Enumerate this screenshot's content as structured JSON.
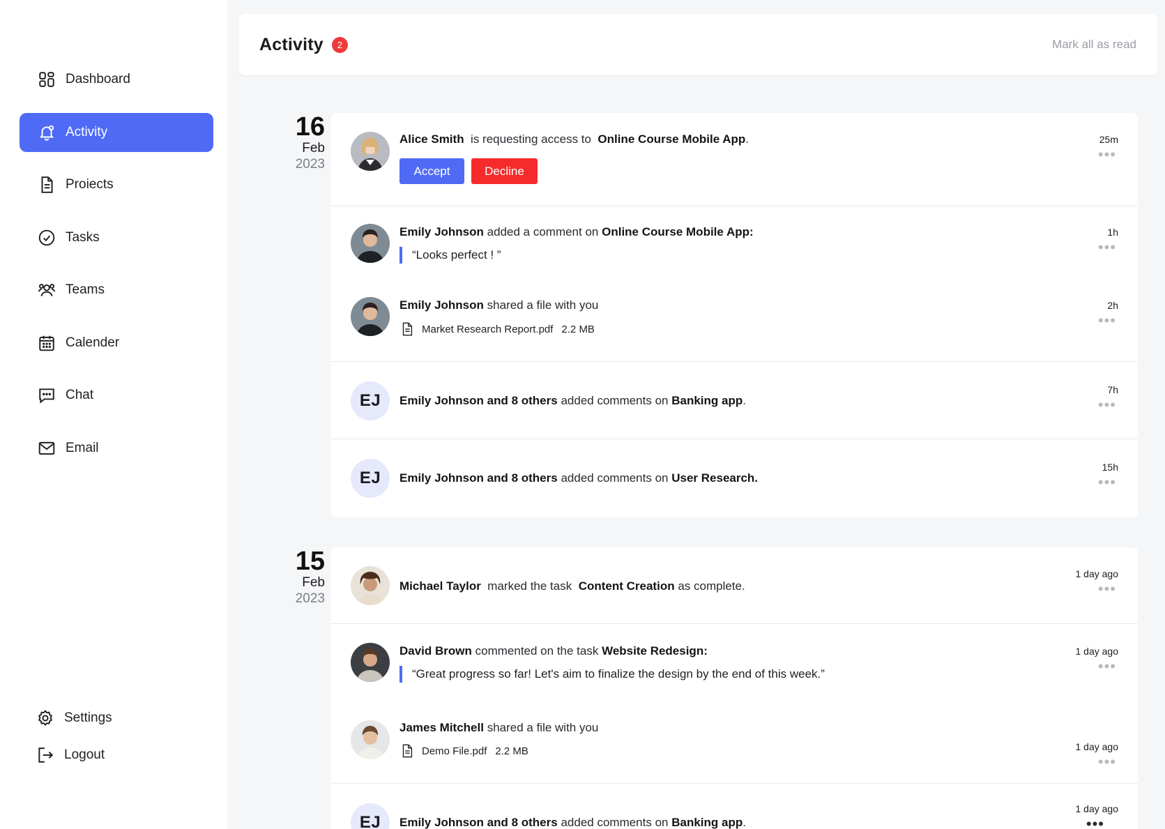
{
  "sidebar": {
    "items": [
      {
        "label": "Dashboard",
        "icon": "dashboard-icon"
      },
      {
        "label": "Activity",
        "icon": "bell-icon",
        "active": true
      },
      {
        "label": "Proiects",
        "icon": "document-icon"
      },
      {
        "label": "Tasks",
        "icon": "check-circle-icon"
      },
      {
        "label": "Teams",
        "icon": "users-icon"
      },
      {
        "label": "Calender",
        "icon": "calendar-icon"
      },
      {
        "label": "Chat",
        "icon": "chat-icon"
      },
      {
        "label": "Email",
        "icon": "mail-icon"
      }
    ],
    "bottom": [
      {
        "label": "Settings",
        "icon": "gear-icon"
      },
      {
        "label": "Logout",
        "icon": "logout-icon"
      }
    ],
    "accent": "#4f6bf6"
  },
  "header": {
    "title": "Activity",
    "badge": "2",
    "mark_all": "Mark all as read"
  },
  "groups": [
    {
      "day": "16",
      "month": "Feb",
      "year": "2023",
      "items": [
        {
          "actor": "Alice Smith",
          "verb": "is requesting access to",
          "target": "Online Course Mobile App",
          "end": ".",
          "time": "25m",
          "accept": "Accept",
          "decline": "Decline"
        },
        {
          "actor": "Emily Johnson",
          "verb": "added a comment on",
          "target": "Online Course Mobile App:",
          "quote": "“Looks perfect ! ”",
          "time": "1h"
        },
        {
          "actor": "Emily Johnson",
          "verb": "shared a file with you",
          "file_name": "Market Research Report.pdf",
          "file_size": "2.2 MB",
          "time": "2h"
        },
        {
          "initials": "EJ",
          "actor": "Emily Johnson and 8 others",
          "verb": "added comments on",
          "target": "Banking app",
          "end": ".",
          "time": "7h"
        },
        {
          "initials": "EJ",
          "actor": "Emily Johnson and 8 others",
          "verb": "added comments on",
          "target": "User Research.",
          "time": "15h"
        }
      ]
    },
    {
      "day": "15",
      "month": "Feb",
      "year": "2023",
      "items": [
        {
          "actor": "Michael Taylor",
          "verb": "marked the task",
          "target": "Content Creation",
          "end": "as complete.",
          "time": "1 day ago"
        },
        {
          "actor": "David Brown",
          "verb": "commented on the task",
          "target": "Website Redesign:",
          "quote": "“Great progress so far! Let's aim to finalize the design by the end of this week.”",
          "time": "1 day ago"
        },
        {
          "actor": "James Mitchell",
          "verb": "shared a file with you",
          "file_name": "Demo File.pdf",
          "file_size": "2.2 MB",
          "time": "1 day ago"
        },
        {
          "initials": "EJ",
          "actor": "Emily Johnson and 8 others",
          "verb": "added comments on",
          "target": "Banking app",
          "end": ".",
          "time": "1 day ago"
        }
      ]
    }
  ],
  "more_icon": "more-horizontal-icon"
}
